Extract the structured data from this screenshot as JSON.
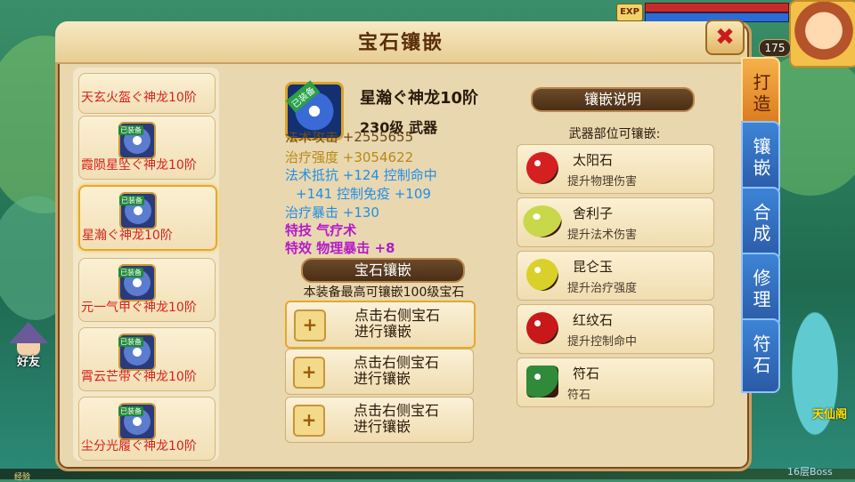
{
  "window": {
    "title": "宝石镶嵌",
    "close_label": "✖"
  },
  "hud": {
    "exp_label": "EXP",
    "level": "175",
    "friend_label": "好友",
    "bottom_exp": "经验",
    "bottom_right": "16层Boss",
    "corner_text": "天仙阁"
  },
  "equipment_list": [
    {
      "name": "天玄火盔ぐ神龙10阶",
      "tag": "已装备"
    },
    {
      "name": "霞陨星坠ぐ神龙10阶",
      "tag": "已装备"
    },
    {
      "name": "星瀚ぐ神龙10阶",
      "tag": "已装备"
    },
    {
      "name": "元一气甲ぐ神龙10阶",
      "tag": "已装备"
    },
    {
      "name": "霄云芒带ぐ神龙10阶",
      "tag": "已装备"
    },
    {
      "name": "尘分光履ぐ神龙10阶",
      "tag": "已装备"
    }
  ],
  "selected_equipment": {
    "name": "星瀚ぐ神龙10阶",
    "tag": "已装备",
    "level_type": "230级  武器",
    "stats": [
      "法术攻击  +2555655",
      "治疗强度  +3054622",
      "法术抵抗  +124  控制命中",
      "+141  控制免疫     +109",
      "治疗暴击  +130",
      "特技  气疗术",
      "特效  物理暴击  +8"
    ]
  },
  "inlay": {
    "section_title": "宝石镶嵌",
    "hint": "本装备最高可镶嵌100级宝石",
    "slots": [
      {
        "line1": "点击右侧宝石",
        "line2": "进行镶嵌",
        "plus": "+"
      },
      {
        "line1": "点击右侧宝石",
        "line2": "进行镶嵌",
        "plus": "+"
      },
      {
        "line1": "点击右侧宝石",
        "line2": "进行镶嵌",
        "plus": "+"
      }
    ]
  },
  "explain": {
    "section_title": "镶嵌说明",
    "subtitle": "武器部位可镶嵌:",
    "gems": [
      {
        "name": "太阳石",
        "desc": "提升物理伤害",
        "color": "#d42020"
      },
      {
        "name": "舍利子",
        "desc": "提升法术伤害",
        "color": "#c9d84a"
      },
      {
        "name": "昆仑玉",
        "desc": "提升治疗强度",
        "color": "#d9d02a"
      },
      {
        "name": "红纹石",
        "desc": "提升控制命中",
        "color": "#c8181a"
      },
      {
        "name": "符石",
        "desc": "符石",
        "color": "#2f8a3a"
      }
    ]
  },
  "side_tabs": [
    {
      "label": "打造",
      "active": true
    },
    {
      "label": "镶嵌",
      "active": false
    },
    {
      "label": "合成",
      "active": false
    },
    {
      "label": "修理",
      "active": false
    },
    {
      "label": "符石",
      "active": false
    }
  ],
  "colors": {
    "stat_gold": "#b58a14",
    "stat_dark": "#3a2a18",
    "stat_blue": "#1f8fe6",
    "stat_purple": "#b51ac9",
    "list_name_red": "#d8201a"
  }
}
